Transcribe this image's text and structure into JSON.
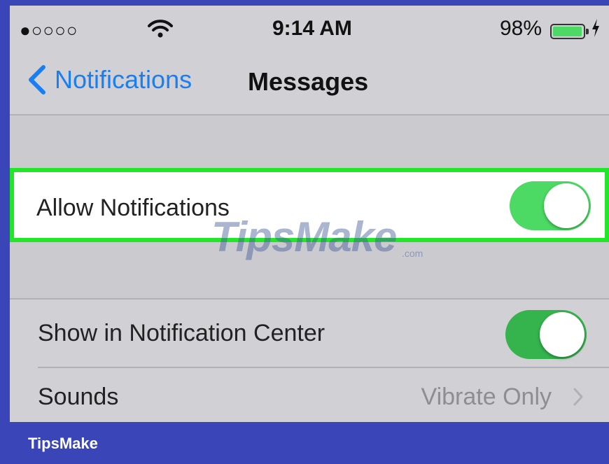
{
  "status_bar": {
    "signal": "●○○○○",
    "time": "9:14 AM",
    "battery_percent": "98%",
    "battery_level": 0.98,
    "icons": [
      "wifi-icon",
      "battery-icon",
      "charging-icon"
    ]
  },
  "nav": {
    "back_label": "Notifications",
    "title": "Messages"
  },
  "settings": {
    "allow_notifications": {
      "label": "Allow Notifications",
      "enabled": true
    },
    "show_in_notification_center": {
      "label": "Show in Notification Center",
      "enabled": true
    },
    "sounds": {
      "label": "Sounds",
      "value": "Vibrate Only"
    }
  },
  "watermark": {
    "text": "TipsMake",
    "sub": ".com"
  },
  "footer": {
    "label": "TipsMake"
  },
  "colors": {
    "accent_blue": "#1a7ef3",
    "toggle_on": "#4cd964",
    "highlight_border": "#22e628",
    "frame": "#3a46b8"
  }
}
